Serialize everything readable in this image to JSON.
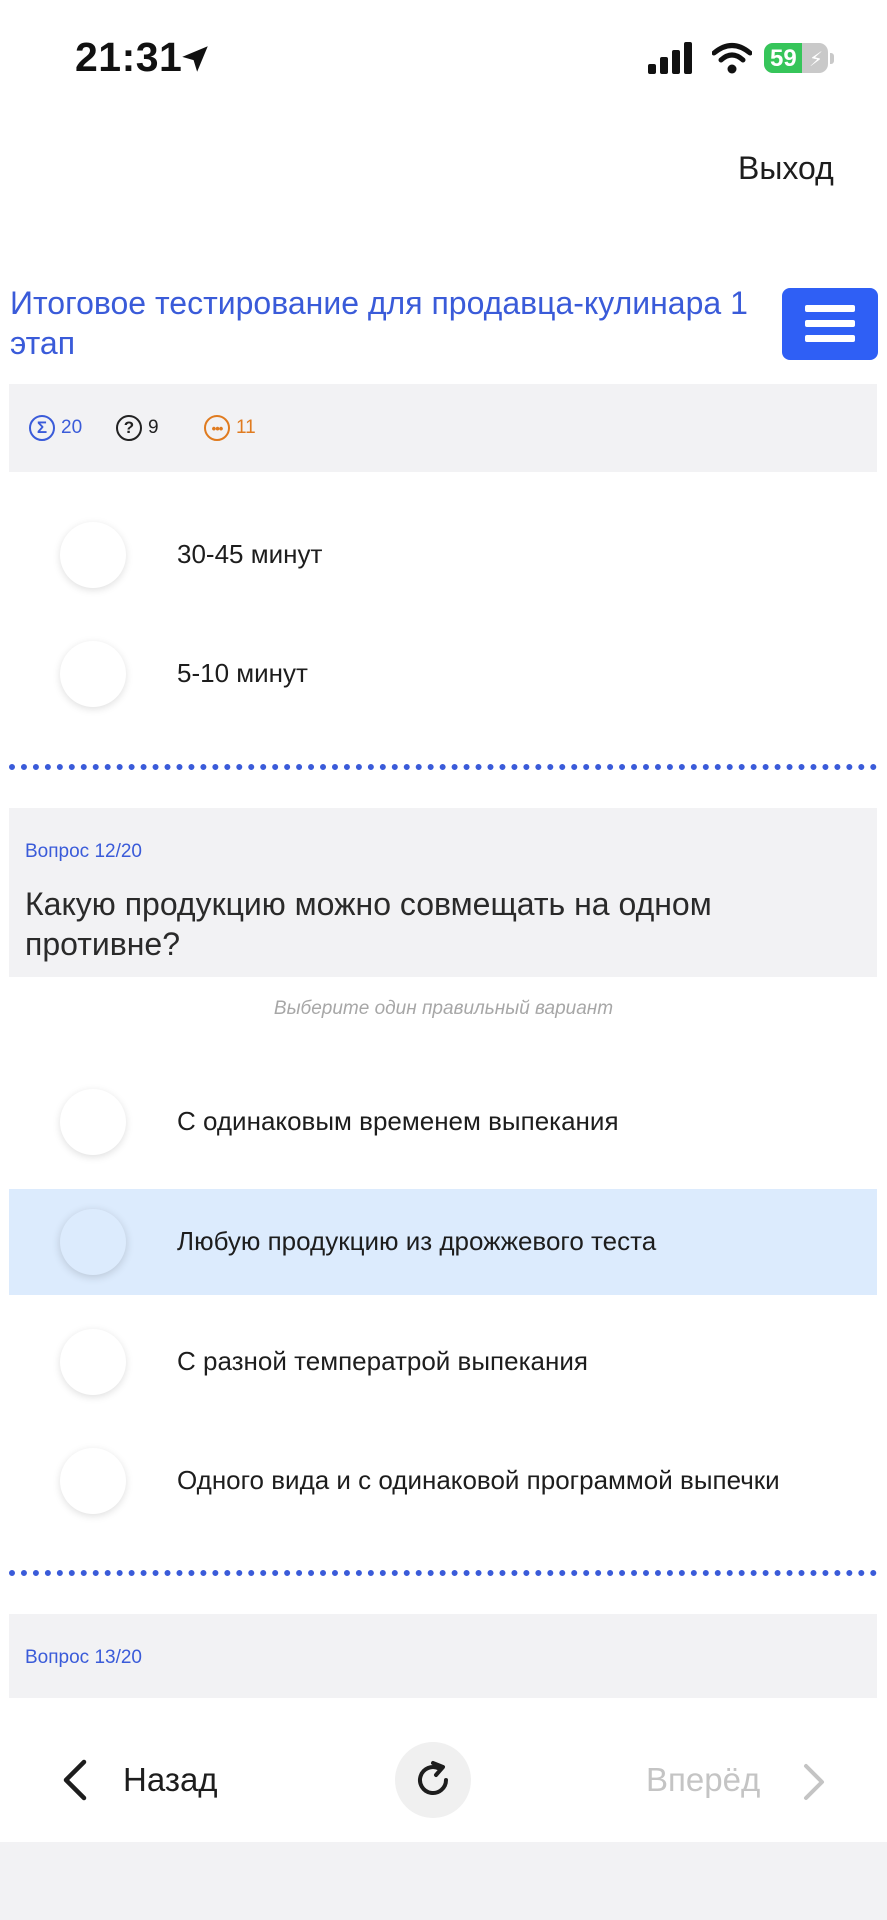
{
  "status_bar": {
    "time": "21:31",
    "battery": "59",
    "battery_level": 0.59
  },
  "header": {
    "exit_label": "Выход",
    "title": "Итоговое тестирование для продавца-кулинара 1 этап"
  },
  "stats": {
    "total": "20",
    "answered": "9",
    "remaining": "11"
  },
  "prev_question": {
    "options": [
      "30-45 минут",
      "5-10 минут"
    ]
  },
  "question": {
    "number": "Вопрос 12/20",
    "text": "Какую продукцию можно совмещать на одном противне?",
    "hint": "Выберите один правильный вариант",
    "options": [
      "С одинаковым временем выпекания",
      "Любую продукцию из дрожжевого теста",
      "С разной температрой выпекания",
      "Одного вида и с одинаковой программой выпечки"
    ],
    "selected_index": 1
  },
  "next_question": {
    "number": "Вопрос 13/20"
  },
  "nav": {
    "back_label": "Назад",
    "next_label": "Вперёд"
  },
  "colors": {
    "accent": "#3a5bd9",
    "menu_button": "#2f5ff5",
    "selected_bg": "#dcebfd",
    "stat_remaining": "#e07b1f"
  }
}
